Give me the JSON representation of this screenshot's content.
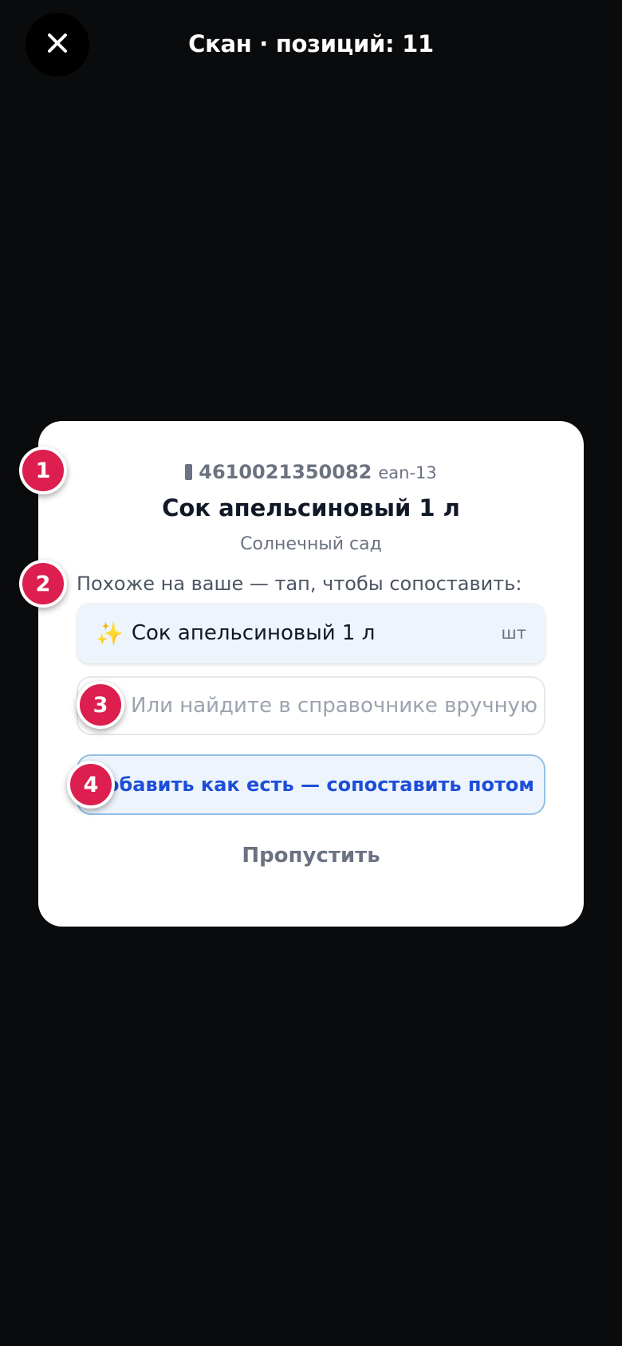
{
  "header": {
    "title": "Скан · позиций: 11",
    "close_icon": "close-icon"
  },
  "product": {
    "barcode_icon": "barcode-icon",
    "barcode": "4610021350082",
    "barcode_format": "ean-13",
    "name": "Сок апельсиновый 1 л",
    "brand": "Солнечный сад"
  },
  "match": {
    "hint": "Похоже на ваше — тап, чтобы сопоставить:",
    "suggestion": {
      "icon": "✨",
      "name": "Сок апельсиновый 1 л",
      "unit": "шт"
    },
    "search_placeholder": "Или найдите в справочнике вручную"
  },
  "actions": {
    "add_as_is": "Добавить как есть — сопоставить потом",
    "skip": "Пропустить"
  },
  "badges": [
    "1",
    "2",
    "3",
    "4"
  ],
  "colors": {
    "background": "#0a0b0d",
    "card": "#ffffff",
    "accent_blue": "#1d4ed8",
    "badge": "#dc1f4e",
    "suggestion_bg": "#eef4fc"
  }
}
